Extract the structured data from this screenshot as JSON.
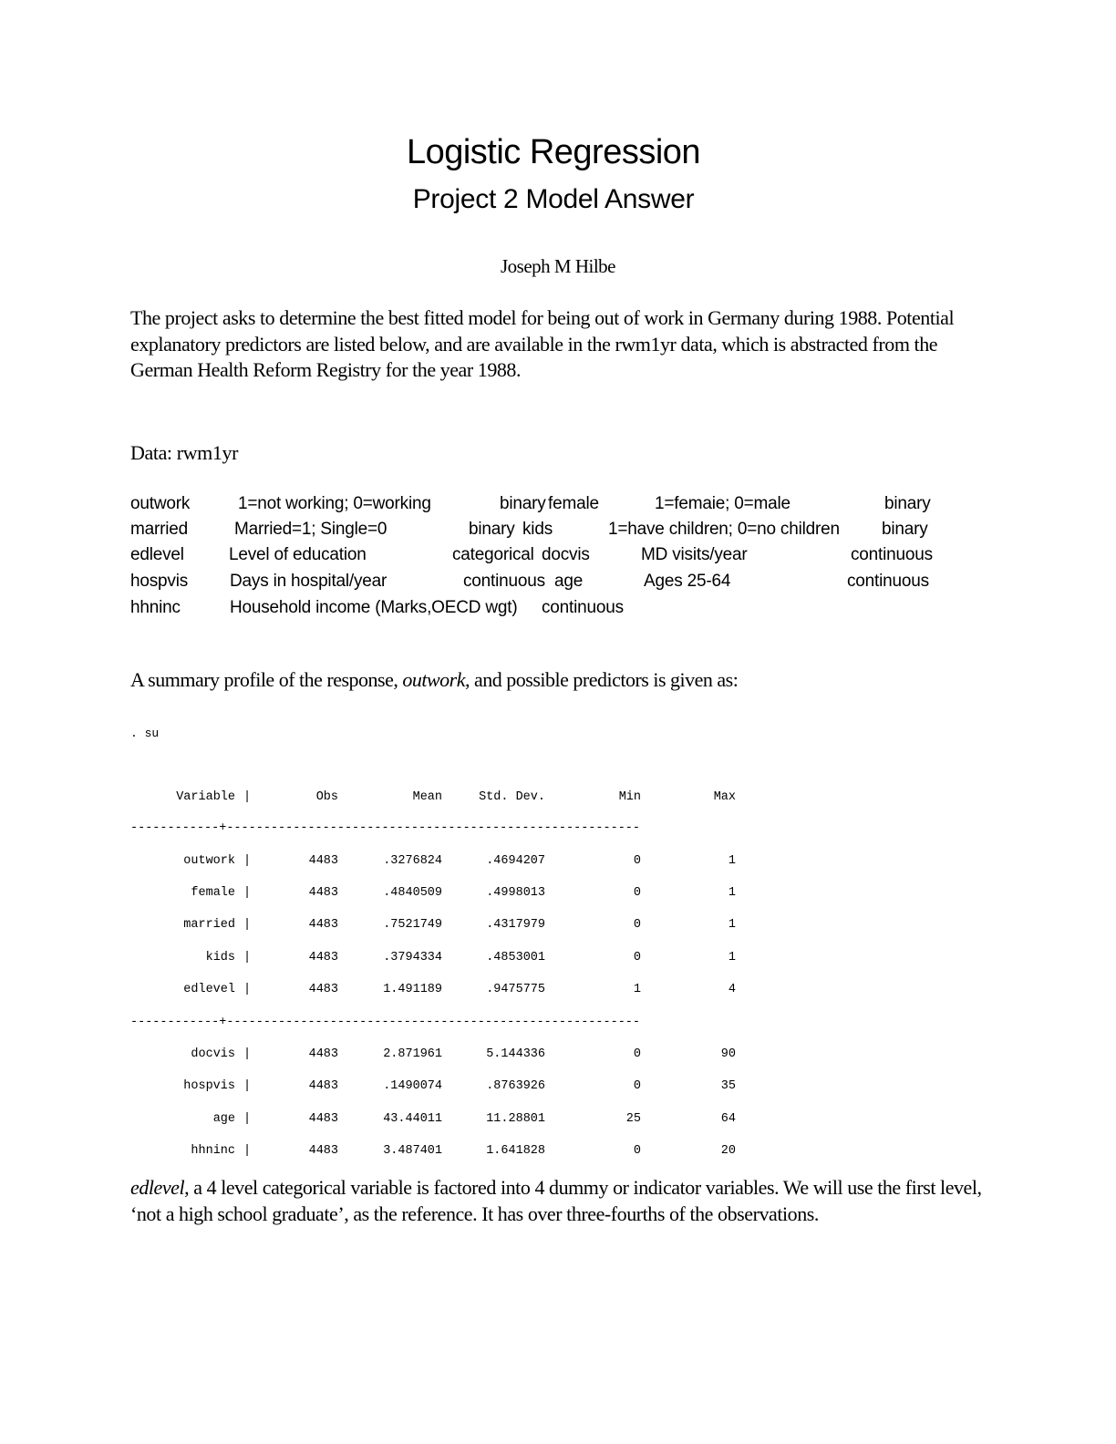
{
  "header": {
    "title": "Logistic Regression",
    "subtitle": "Project 2 Model Answer",
    "author": "Joseph M Hilbe"
  },
  "intro_paragraph": "The project asks to determine the best fitted model for being out of work in Germany during 1988. Potential explanatory predictors are listed below, and are available in the rwm1yr data, which is abstracted from the German Health Reform Registry for the year 1988.",
  "data_label": "Data: rwm1yr",
  "variables": {
    "left": [
      {
        "name": "outwork",
        "description": "1=not working; 0=working",
        "type": "binary"
      },
      {
        "name": "married",
        "description": "Married=1; Single=0",
        "type": "binary"
      },
      {
        "name": "edlevel",
        "description": "Level of education",
        "type": "categorical"
      },
      {
        "name": "hospvis",
        "description": "Days in hospital/year",
        "type": "continuous"
      },
      {
        "name": "hhninc",
        "description": "Household income (Marks,OECD wgt)",
        "type": "continuous"
      }
    ],
    "right": [
      {
        "name": "female",
        "description": "1=femaie; 0=male",
        "type": "binary"
      },
      {
        "name": "kids",
        "description": "1=have children; 0=no children",
        "type": "binary"
      },
      {
        "name": "docvis",
        "description": "MD visits/year",
        "type": "continuous"
      },
      {
        "name": "age",
        "description": "Ages 25-64",
        "type": "continuous"
      }
    ]
  },
  "summary_intro": {
    "before": "A summary profile of the response, ",
    "emphasis": "outwork",
    "after": ", and possible predictors is given as:"
  },
  "command": ". su",
  "summary_table": {
    "headers": [
      "Variable",
      "Obs",
      "Mean",
      "Std. Dev.",
      "Min",
      "Max"
    ],
    "separator_char": "|",
    "divider_left": "------------",
    "divider_plus": "+",
    "divider_right": "--------------------------------------------------------",
    "groups": [
      [
        [
          "outwork",
          "4483",
          ".3276824",
          ".4694207",
          "0",
          "1"
        ],
        [
          "female",
          "4483",
          ".4840509",
          ".4998013",
          "0",
          "1"
        ],
        [
          "married",
          "4483",
          ".7521749",
          ".4317979",
          "0",
          "1"
        ],
        [
          "kids",
          "4483",
          ".3794334",
          ".4853001",
          "0",
          "1"
        ],
        [
          "edlevel",
          "4483",
          "1.491189",
          ".9475775",
          "1",
          "4"
        ]
      ],
      [
        [
          "docvis",
          "4483",
          "2.871961",
          "5.144336",
          "0",
          "90"
        ],
        [
          "hospvis",
          "4483",
          ".1490074",
          ".8763926",
          "0",
          "35"
        ],
        [
          "age",
          "4483",
          "43.44011",
          "11.28801",
          "25",
          "64"
        ],
        [
          "hhninc",
          "4483",
          "3.487401",
          "1.641828",
          "0",
          "20"
        ]
      ]
    ]
  },
  "closing_paragraph": {
    "emphasis": "edlevel",
    "text": ", a 4 level categorical variable is factored into 4 dummy or indicator variables. We will use the first level, ‘not a high school graduate’, as the reference. It has over three-fourths of the observations."
  }
}
